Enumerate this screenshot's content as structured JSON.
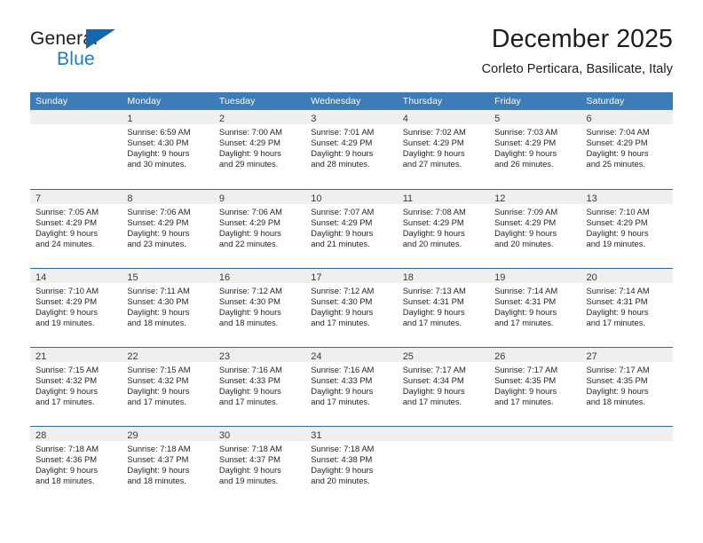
{
  "brand": {
    "name_part1": "General",
    "name_part2": "Blue",
    "triangle_icon": "triangle-icon",
    "color_dark": "#1d1d1b",
    "color_blue": "#1d7cc4"
  },
  "header": {
    "title": "December 2025",
    "subtitle": "Corleto Perticara, Basilicate, Italy"
  },
  "theme": {
    "header_bg": "#3b7cb9",
    "row_divider": "#2f6ca6",
    "daynum_band": "#efefef",
    "text": "#262626"
  },
  "weekdays": [
    "Sunday",
    "Monday",
    "Tuesday",
    "Wednesday",
    "Thursday",
    "Friday",
    "Saturday"
  ],
  "weeks": [
    [
      {
        "day": "",
        "lines": []
      },
      {
        "day": "1",
        "lines": [
          "Sunrise: 6:59 AM",
          "Sunset: 4:30 PM",
          "Daylight: 9 hours",
          "and 30 minutes."
        ]
      },
      {
        "day": "2",
        "lines": [
          "Sunrise: 7:00 AM",
          "Sunset: 4:29 PM",
          "Daylight: 9 hours",
          "and 29 minutes."
        ]
      },
      {
        "day": "3",
        "lines": [
          "Sunrise: 7:01 AM",
          "Sunset: 4:29 PM",
          "Daylight: 9 hours",
          "and 28 minutes."
        ]
      },
      {
        "day": "4",
        "lines": [
          "Sunrise: 7:02 AM",
          "Sunset: 4:29 PM",
          "Daylight: 9 hours",
          "and 27 minutes."
        ]
      },
      {
        "day": "5",
        "lines": [
          "Sunrise: 7:03 AM",
          "Sunset: 4:29 PM",
          "Daylight: 9 hours",
          "and 26 minutes."
        ]
      },
      {
        "day": "6",
        "lines": [
          "Sunrise: 7:04 AM",
          "Sunset: 4:29 PM",
          "Daylight: 9 hours",
          "and 25 minutes."
        ]
      }
    ],
    [
      {
        "day": "7",
        "lines": [
          "Sunrise: 7:05 AM",
          "Sunset: 4:29 PM",
          "Daylight: 9 hours",
          "and 24 minutes."
        ]
      },
      {
        "day": "8",
        "lines": [
          "Sunrise: 7:06 AM",
          "Sunset: 4:29 PM",
          "Daylight: 9 hours",
          "and 23 minutes."
        ]
      },
      {
        "day": "9",
        "lines": [
          "Sunrise: 7:06 AM",
          "Sunset: 4:29 PM",
          "Daylight: 9 hours",
          "and 22 minutes."
        ]
      },
      {
        "day": "10",
        "lines": [
          "Sunrise: 7:07 AM",
          "Sunset: 4:29 PM",
          "Daylight: 9 hours",
          "and 21 minutes."
        ]
      },
      {
        "day": "11",
        "lines": [
          "Sunrise: 7:08 AM",
          "Sunset: 4:29 PM",
          "Daylight: 9 hours",
          "and 20 minutes."
        ]
      },
      {
        "day": "12",
        "lines": [
          "Sunrise: 7:09 AM",
          "Sunset: 4:29 PM",
          "Daylight: 9 hours",
          "and 20 minutes."
        ]
      },
      {
        "day": "13",
        "lines": [
          "Sunrise: 7:10 AM",
          "Sunset: 4:29 PM",
          "Daylight: 9 hours",
          "and 19 minutes."
        ]
      }
    ],
    [
      {
        "day": "14",
        "lines": [
          "Sunrise: 7:10 AM",
          "Sunset: 4:29 PM",
          "Daylight: 9 hours",
          "and 19 minutes."
        ]
      },
      {
        "day": "15",
        "lines": [
          "Sunrise: 7:11 AM",
          "Sunset: 4:30 PM",
          "Daylight: 9 hours",
          "and 18 minutes."
        ]
      },
      {
        "day": "16",
        "lines": [
          "Sunrise: 7:12 AM",
          "Sunset: 4:30 PM",
          "Daylight: 9 hours",
          "and 18 minutes."
        ]
      },
      {
        "day": "17",
        "lines": [
          "Sunrise: 7:12 AM",
          "Sunset: 4:30 PM",
          "Daylight: 9 hours",
          "and 17 minutes."
        ]
      },
      {
        "day": "18",
        "lines": [
          "Sunrise: 7:13 AM",
          "Sunset: 4:31 PM",
          "Daylight: 9 hours",
          "and 17 minutes."
        ]
      },
      {
        "day": "19",
        "lines": [
          "Sunrise: 7:14 AM",
          "Sunset: 4:31 PM",
          "Daylight: 9 hours",
          "and 17 minutes."
        ]
      },
      {
        "day": "20",
        "lines": [
          "Sunrise: 7:14 AM",
          "Sunset: 4:31 PM",
          "Daylight: 9 hours",
          "and 17 minutes."
        ]
      }
    ],
    [
      {
        "day": "21",
        "lines": [
          "Sunrise: 7:15 AM",
          "Sunset: 4:32 PM",
          "Daylight: 9 hours",
          "and 17 minutes."
        ]
      },
      {
        "day": "22",
        "lines": [
          "Sunrise: 7:15 AM",
          "Sunset: 4:32 PM",
          "Daylight: 9 hours",
          "and 17 minutes."
        ]
      },
      {
        "day": "23",
        "lines": [
          "Sunrise: 7:16 AM",
          "Sunset: 4:33 PM",
          "Daylight: 9 hours",
          "and 17 minutes."
        ]
      },
      {
        "day": "24",
        "lines": [
          "Sunrise: 7:16 AM",
          "Sunset: 4:33 PM",
          "Daylight: 9 hours",
          "and 17 minutes."
        ]
      },
      {
        "day": "25",
        "lines": [
          "Sunrise: 7:17 AM",
          "Sunset: 4:34 PM",
          "Daylight: 9 hours",
          "and 17 minutes."
        ]
      },
      {
        "day": "26",
        "lines": [
          "Sunrise: 7:17 AM",
          "Sunset: 4:35 PM",
          "Daylight: 9 hours",
          "and 17 minutes."
        ]
      },
      {
        "day": "27",
        "lines": [
          "Sunrise: 7:17 AM",
          "Sunset: 4:35 PM",
          "Daylight: 9 hours",
          "and 18 minutes."
        ]
      }
    ],
    [
      {
        "day": "28",
        "lines": [
          "Sunrise: 7:18 AM",
          "Sunset: 4:36 PM",
          "Daylight: 9 hours",
          "and 18 minutes."
        ]
      },
      {
        "day": "29",
        "lines": [
          "Sunrise: 7:18 AM",
          "Sunset: 4:37 PM",
          "Daylight: 9 hours",
          "and 18 minutes."
        ]
      },
      {
        "day": "30",
        "lines": [
          "Sunrise: 7:18 AM",
          "Sunset: 4:37 PM",
          "Daylight: 9 hours",
          "and 19 minutes."
        ]
      },
      {
        "day": "31",
        "lines": [
          "Sunrise: 7:18 AM",
          "Sunset: 4:38 PM",
          "Daylight: 9 hours",
          "and 20 minutes."
        ]
      },
      {
        "day": "",
        "lines": []
      },
      {
        "day": "",
        "lines": []
      },
      {
        "day": "",
        "lines": []
      }
    ]
  ]
}
